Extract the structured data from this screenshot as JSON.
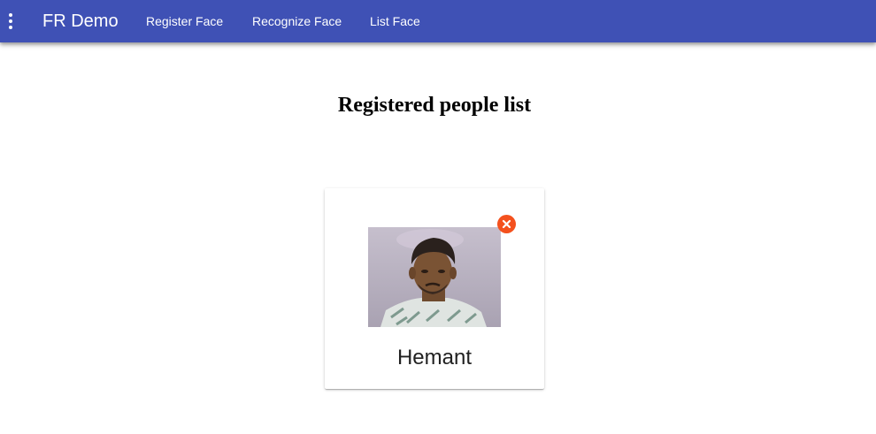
{
  "colors": {
    "appbar": "#3f51b5",
    "remove_button": "#f4511e",
    "text_on_appbar": "#ffffff"
  },
  "header": {
    "menu_icon": "more-vert-icon",
    "title": "FR Demo",
    "nav": [
      {
        "label": "Register Face"
      },
      {
        "label": "Recognize Face"
      },
      {
        "label": "List Face"
      }
    ]
  },
  "main": {
    "title": "Registered people list",
    "people": [
      {
        "name": "Hemant",
        "photo_alt": "Hemant",
        "remove_icon": "close-circle-icon"
      }
    ]
  }
}
